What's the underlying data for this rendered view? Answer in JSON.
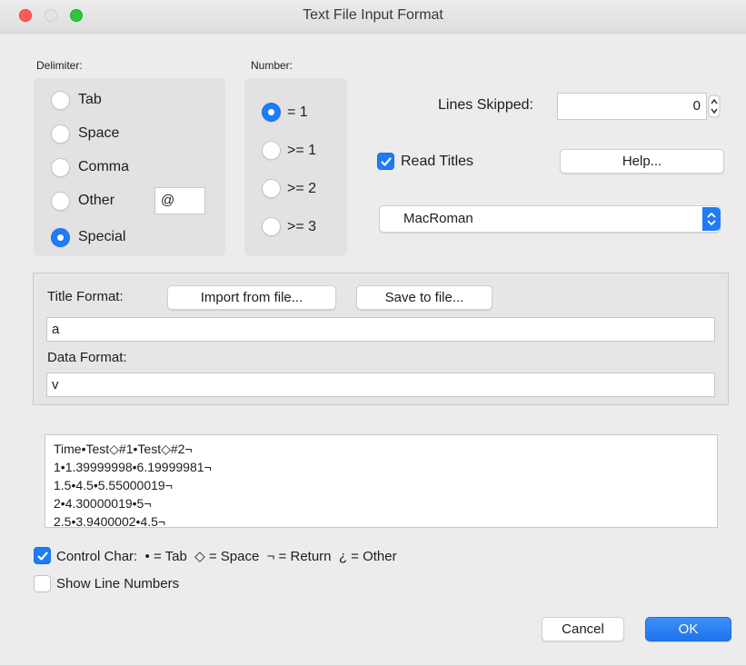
{
  "window": {
    "title": "Text File Input Format"
  },
  "delimiter": {
    "heading": "Delimiter:",
    "options": [
      {
        "label": "Tab",
        "selected": false
      },
      {
        "label": "Space",
        "selected": false
      },
      {
        "label": "Comma",
        "selected": false
      },
      {
        "label": "Other",
        "selected": false
      },
      {
        "label": "Special",
        "selected": true
      }
    ],
    "other_value": "@"
  },
  "number": {
    "heading": "Number:",
    "options": [
      {
        "label": "= 1",
        "selected": true
      },
      {
        "label": ">= 1",
        "selected": false
      },
      {
        "label": ">= 2",
        "selected": false
      },
      {
        "label": ">= 3",
        "selected": false
      }
    ]
  },
  "lines_skipped": {
    "label": "Lines Skipped:",
    "value": "0"
  },
  "read_titles": {
    "label": "Read Titles",
    "checked": true
  },
  "help_button": "Help...",
  "encoding": {
    "selected": "MacRoman"
  },
  "format": {
    "title_label": "Title Format:",
    "import_button": "Import from file...",
    "save_button": "Save to file...",
    "title_value": "a",
    "data_label": "Data Format:",
    "data_value": "v"
  },
  "preview": {
    "lines": [
      "Time•Test◇#1•Test◇#2¬",
      "1•1.39999998•6.19999981¬",
      "1.5•4.5•5.55000019¬",
      "2•4.30000019•5¬",
      "2.5•3.9400002•4.5¬"
    ]
  },
  "control_char": {
    "label": "Control Char:  • = Tab  ◇ = Space  ¬ = Return  ¿ = Other",
    "checked": true
  },
  "show_line_numbers": {
    "label": "Show Line Numbers",
    "checked": false
  },
  "buttons": {
    "cancel": "Cancel",
    "ok": "OK"
  },
  "colors": {
    "accent": "#1f7bf6",
    "window_bg": "#ececec",
    "group_bg": "#e2e2e2"
  }
}
